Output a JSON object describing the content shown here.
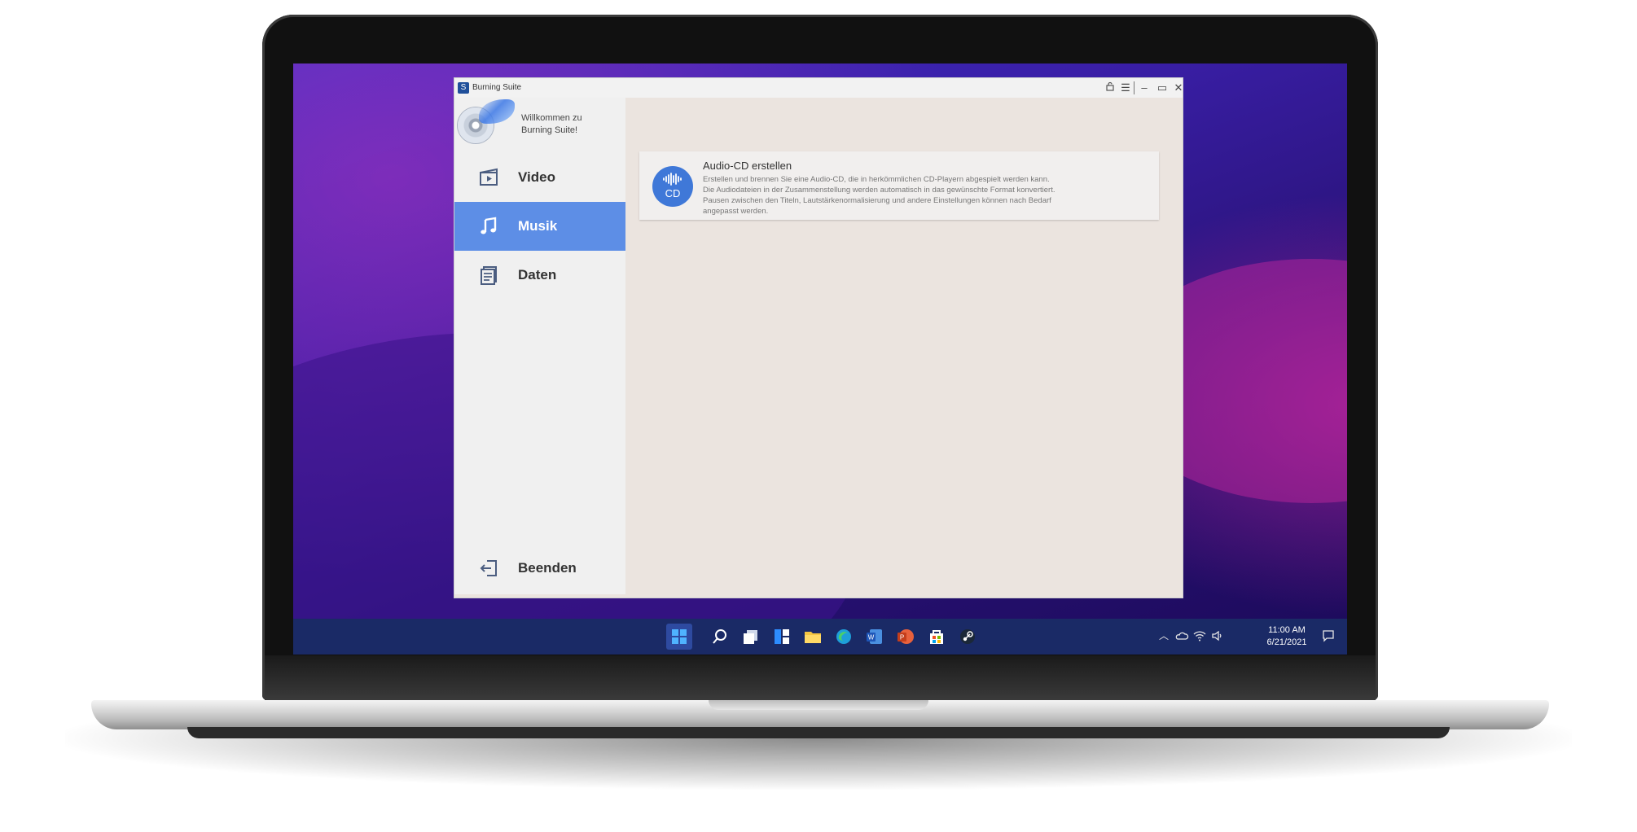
{
  "window": {
    "title": "Burning Suite",
    "welcome": "Willkommen zu Burning Suite!"
  },
  "sidebar": {
    "items": [
      {
        "label": "Video",
        "icon": "video-icon",
        "active": false
      },
      {
        "label": "Musik",
        "icon": "music-note-icon",
        "active": true
      },
      {
        "label": "Daten",
        "icon": "document-icon",
        "active": false
      }
    ],
    "exit_label": "Beenden"
  },
  "main": {
    "card": {
      "title": "Audio-CD erstellen",
      "icon_text": "CD",
      "description": [
        "Erstellen und brennen Sie eine Audio-CD, die in herkömmlichen CD-Playern abgespielt werden kann.",
        "Die Audiodateien in der Zusammenstellung werden automatisch in das gewünschte Format konvertiert.",
        "Pausen zwischen den Titeln, Lautstärkenormalisierung und andere Einstellungen können nach Bedarf",
        "angepasst werden."
      ]
    }
  },
  "taskbar": {
    "time": "11:00 AM",
    "date": "6/21/2021"
  },
  "colors": {
    "accent": "#5d8ee6",
    "card_icon": "#3f78d8",
    "taskbar": "#1a2a66",
    "app_bg": "#ebe4df"
  }
}
